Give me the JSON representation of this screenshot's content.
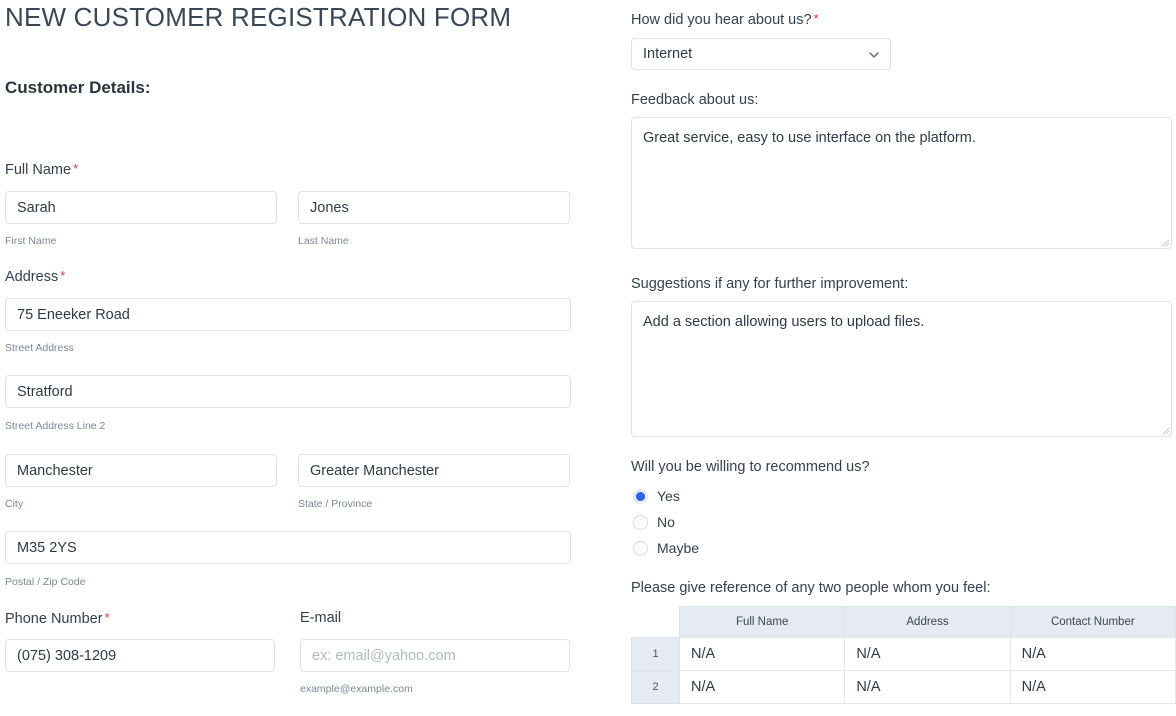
{
  "form": {
    "title": "NEW CUSTOMER REGISTRATION FORM",
    "section_title": "Customer Details:",
    "required_marker": "*"
  },
  "colors": {
    "accent": "#2b63e8",
    "required": "#e9304a",
    "text": "#34404e",
    "muted": "#7b8794",
    "border": "#dfe2e6",
    "table_header_bg": "#e6eaf2"
  },
  "left": {
    "full_name": {
      "label": "Full Name",
      "required": true,
      "first": {
        "value": "Sarah",
        "sub_label": "First Name",
        "placeholder": ""
      },
      "last": {
        "value": "Jones",
        "sub_label": "Last Name",
        "placeholder": ""
      }
    },
    "address": {
      "label": "Address",
      "required": true,
      "street": {
        "value": "75 Eneeker Road",
        "sub_label": "Street Address",
        "placeholder": ""
      },
      "street2": {
        "value": "Stratford",
        "sub_label": "Street Address Line 2",
        "placeholder": ""
      },
      "city": {
        "value": "Manchester",
        "sub_label": "City",
        "placeholder": ""
      },
      "state": {
        "value": "Greater Manchester",
        "sub_label": "State / Province",
        "placeholder": ""
      },
      "zip": {
        "value": "M35 2YS",
        "sub_label": "Postal / Zip Code",
        "placeholder": ""
      }
    },
    "phone": {
      "label": "Phone Number",
      "required": true,
      "value": "(075) 308-1209",
      "placeholder": ""
    },
    "email": {
      "label": "E-mail",
      "required": false,
      "value": "",
      "placeholder": "ex: email@yahoo.com",
      "hint": "example@example.com"
    }
  },
  "right": {
    "hear_about": {
      "label": "How did you hear about us?",
      "required": true,
      "selected": "Internet",
      "caret_icon": "chevron-down-icon"
    },
    "feedback": {
      "label": "Feedback about us:",
      "value": "Great service, easy to use interface on the platform.",
      "placeholder": ""
    },
    "suggestions": {
      "label": "Suggestions if any for further improvement:",
      "value": "Add a section allowing users to upload files.",
      "placeholder": ""
    },
    "recommend": {
      "label": "Will you be willing to recommend us?",
      "options": [
        {
          "label": "Yes",
          "checked": true
        },
        {
          "label": "No",
          "checked": false
        },
        {
          "label": "Maybe",
          "checked": false
        }
      ]
    },
    "reference": {
      "label": "Please give reference of any two people whom you feel:",
      "columns": [
        "Full Name",
        "Address",
        "Contact Number"
      ],
      "rows": [
        {
          "num": "1",
          "cells": [
            "N/A",
            "N/A",
            "N/A"
          ]
        },
        {
          "num": "2",
          "cells": [
            "N/A",
            "N/A",
            "N/A"
          ]
        }
      ]
    }
  }
}
